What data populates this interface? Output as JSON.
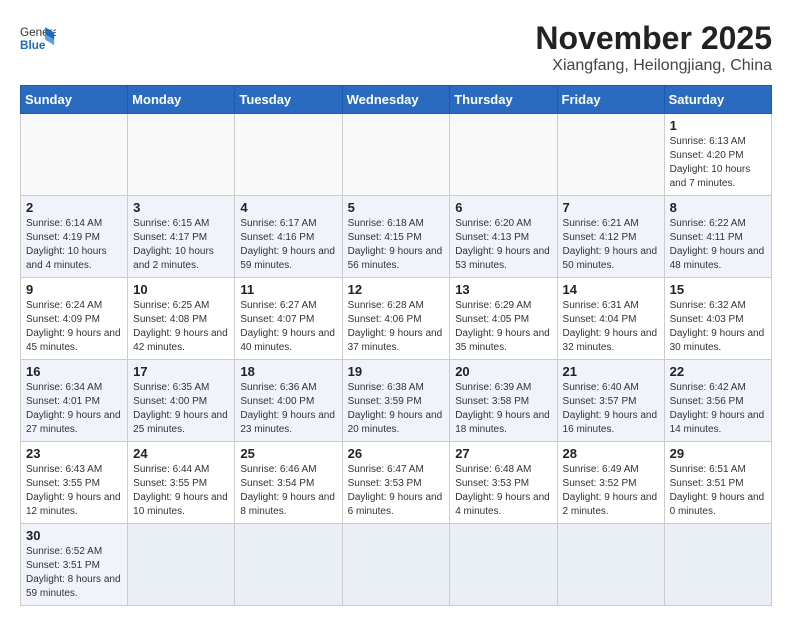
{
  "header": {
    "logo_general": "General",
    "logo_blue": "Blue",
    "month": "November 2025",
    "location": "Xiangfang, Heilongjiang, China"
  },
  "weekdays": [
    "Sunday",
    "Monday",
    "Tuesday",
    "Wednesday",
    "Thursday",
    "Friday",
    "Saturday"
  ],
  "weeks": [
    [
      {
        "day": "",
        "info": ""
      },
      {
        "day": "",
        "info": ""
      },
      {
        "day": "",
        "info": ""
      },
      {
        "day": "",
        "info": ""
      },
      {
        "day": "",
        "info": ""
      },
      {
        "day": "",
        "info": ""
      },
      {
        "day": "1",
        "info": "Sunrise: 6:13 AM\nSunset: 4:20 PM\nDaylight: 10 hours and 7 minutes."
      }
    ],
    [
      {
        "day": "2",
        "info": "Sunrise: 6:14 AM\nSunset: 4:19 PM\nDaylight: 10 hours and 4 minutes."
      },
      {
        "day": "3",
        "info": "Sunrise: 6:15 AM\nSunset: 4:17 PM\nDaylight: 10 hours and 2 minutes."
      },
      {
        "day": "4",
        "info": "Sunrise: 6:17 AM\nSunset: 4:16 PM\nDaylight: 9 hours and 59 minutes."
      },
      {
        "day": "5",
        "info": "Sunrise: 6:18 AM\nSunset: 4:15 PM\nDaylight: 9 hours and 56 minutes."
      },
      {
        "day": "6",
        "info": "Sunrise: 6:20 AM\nSunset: 4:13 PM\nDaylight: 9 hours and 53 minutes."
      },
      {
        "day": "7",
        "info": "Sunrise: 6:21 AM\nSunset: 4:12 PM\nDaylight: 9 hours and 50 minutes."
      },
      {
        "day": "8",
        "info": "Sunrise: 6:22 AM\nSunset: 4:11 PM\nDaylight: 9 hours and 48 minutes."
      }
    ],
    [
      {
        "day": "9",
        "info": "Sunrise: 6:24 AM\nSunset: 4:09 PM\nDaylight: 9 hours and 45 minutes."
      },
      {
        "day": "10",
        "info": "Sunrise: 6:25 AM\nSunset: 4:08 PM\nDaylight: 9 hours and 42 minutes."
      },
      {
        "day": "11",
        "info": "Sunrise: 6:27 AM\nSunset: 4:07 PM\nDaylight: 9 hours and 40 minutes."
      },
      {
        "day": "12",
        "info": "Sunrise: 6:28 AM\nSunset: 4:06 PM\nDaylight: 9 hours and 37 minutes."
      },
      {
        "day": "13",
        "info": "Sunrise: 6:29 AM\nSunset: 4:05 PM\nDaylight: 9 hours and 35 minutes."
      },
      {
        "day": "14",
        "info": "Sunrise: 6:31 AM\nSunset: 4:04 PM\nDaylight: 9 hours and 32 minutes."
      },
      {
        "day": "15",
        "info": "Sunrise: 6:32 AM\nSunset: 4:03 PM\nDaylight: 9 hours and 30 minutes."
      }
    ],
    [
      {
        "day": "16",
        "info": "Sunrise: 6:34 AM\nSunset: 4:01 PM\nDaylight: 9 hours and 27 minutes."
      },
      {
        "day": "17",
        "info": "Sunrise: 6:35 AM\nSunset: 4:00 PM\nDaylight: 9 hours and 25 minutes."
      },
      {
        "day": "18",
        "info": "Sunrise: 6:36 AM\nSunset: 4:00 PM\nDaylight: 9 hours and 23 minutes."
      },
      {
        "day": "19",
        "info": "Sunrise: 6:38 AM\nSunset: 3:59 PM\nDaylight: 9 hours and 20 minutes."
      },
      {
        "day": "20",
        "info": "Sunrise: 6:39 AM\nSunset: 3:58 PM\nDaylight: 9 hours and 18 minutes."
      },
      {
        "day": "21",
        "info": "Sunrise: 6:40 AM\nSunset: 3:57 PM\nDaylight: 9 hours and 16 minutes."
      },
      {
        "day": "22",
        "info": "Sunrise: 6:42 AM\nSunset: 3:56 PM\nDaylight: 9 hours and 14 minutes."
      }
    ],
    [
      {
        "day": "23",
        "info": "Sunrise: 6:43 AM\nSunset: 3:55 PM\nDaylight: 9 hours and 12 minutes."
      },
      {
        "day": "24",
        "info": "Sunrise: 6:44 AM\nSunset: 3:55 PM\nDaylight: 9 hours and 10 minutes."
      },
      {
        "day": "25",
        "info": "Sunrise: 6:46 AM\nSunset: 3:54 PM\nDaylight: 9 hours and 8 minutes."
      },
      {
        "day": "26",
        "info": "Sunrise: 6:47 AM\nSunset: 3:53 PM\nDaylight: 9 hours and 6 minutes."
      },
      {
        "day": "27",
        "info": "Sunrise: 6:48 AM\nSunset: 3:53 PM\nDaylight: 9 hours and 4 minutes."
      },
      {
        "day": "28",
        "info": "Sunrise: 6:49 AM\nSunset: 3:52 PM\nDaylight: 9 hours and 2 minutes."
      },
      {
        "day": "29",
        "info": "Sunrise: 6:51 AM\nSunset: 3:51 PM\nDaylight: 9 hours and 0 minutes."
      }
    ],
    [
      {
        "day": "30",
        "info": "Sunrise: 6:52 AM\nSunset: 3:51 PM\nDaylight: 8 hours and 59 minutes."
      },
      {
        "day": "",
        "info": ""
      },
      {
        "day": "",
        "info": ""
      },
      {
        "day": "",
        "info": ""
      },
      {
        "day": "",
        "info": ""
      },
      {
        "day": "",
        "info": ""
      },
      {
        "day": "",
        "info": ""
      }
    ]
  ]
}
